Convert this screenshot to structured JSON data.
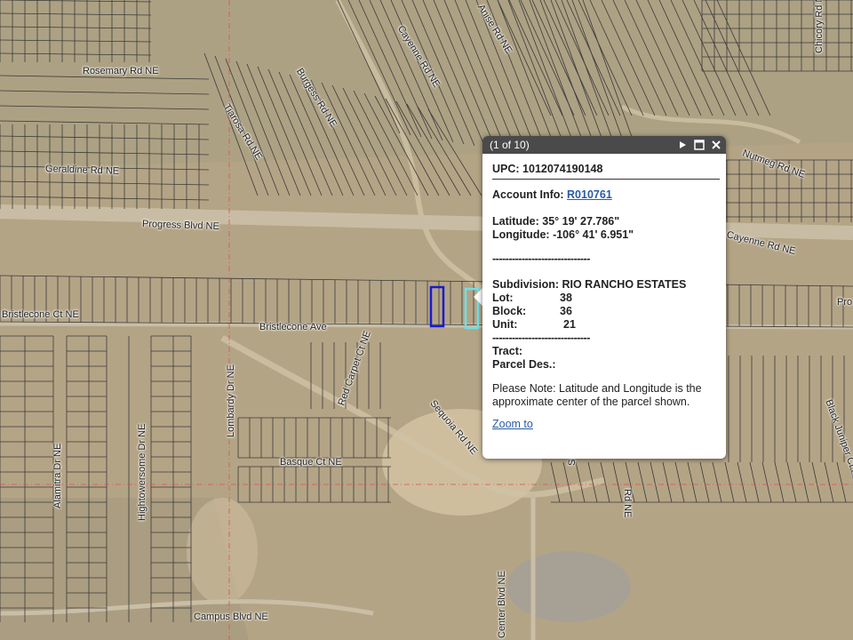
{
  "map": {
    "street_labels": [
      {
        "text": "Rosemary Rd NE"
      },
      {
        "text": "Burgess Rd NE"
      },
      {
        "text": "Cayenne Rd NE"
      },
      {
        "text": "Anise Rd NE"
      },
      {
        "text": "Chicory Rd NE"
      },
      {
        "text": "Tiarosa Rd NE"
      },
      {
        "text": "Geraldine Rd NE"
      },
      {
        "text": "Nutmeg Rd NE"
      },
      {
        "text": "Progress Blvd NE"
      },
      {
        "text": "Cayenne Rd NE"
      },
      {
        "text": "Pro"
      },
      {
        "text": "Bristlecone Ct NE"
      },
      {
        "text": "Bristlecone Ave"
      },
      {
        "text": "Red Carpet Ct NE"
      },
      {
        "text": "Sequoia Rd NE"
      },
      {
        "text": "Lombardy Dr NE"
      },
      {
        "text": "Alamitra Dr NE"
      },
      {
        "text": "Hightowersome Dr NE"
      },
      {
        "text": "Basque Ct NE"
      },
      {
        "text": "Black Juniper Ct NE"
      },
      {
        "text": "Sc"
      },
      {
        "text": "Rd NE"
      },
      {
        "text": "Campus Blvd NE"
      },
      {
        "text": "Center Blvd NE"
      }
    ],
    "selection_colors": {
      "primary": "#1a1ad6",
      "secondary": "#6fe0e6"
    }
  },
  "popup": {
    "pager": "(1 of 10)",
    "upc_label": "UPC:",
    "upc_value": "1012074190148",
    "account_label": "Account Info:",
    "account_link": "R010761",
    "latitude_label": "Latitude:",
    "latitude_value": "35° 19' 27.786\"",
    "longitude_label": "Longitude:",
    "longitude_value": "-106° 41' 6.951\"",
    "divider_1": "------------------------------",
    "subdivision_label": "Subdivision:",
    "subdivision_value": "RIO RANCHO ESTATES",
    "lot_label": "Lot:",
    "lot_value": "38",
    "block_label": "Block:",
    "block_value": "36",
    "unit_label": "Unit:",
    "unit_value": "21",
    "divider_2": "------------------------------",
    "tract_label": "Tract:",
    "parcel_label": "Parcel Des.:",
    "note": "Please Note: Latitude and Longitude is the approximate center of the parcel shown.",
    "zoom_label": "Zoom to"
  }
}
